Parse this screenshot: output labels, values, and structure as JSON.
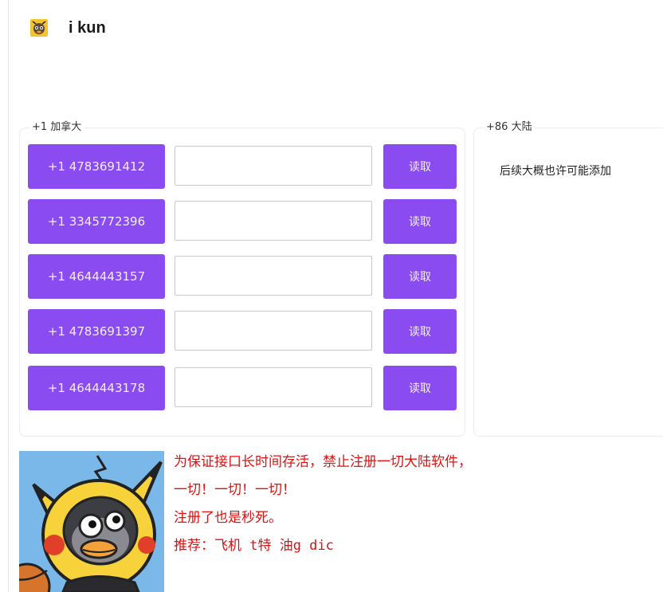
{
  "app": {
    "title": "i kun",
    "logo_icon": "kun-mascot-icon"
  },
  "panels": {
    "canada": {
      "legend": "+1 加拿大",
      "read_label": "读取",
      "numbers": [
        "+1 4783691412",
        "+1 3345772396",
        "+1 4644443157",
        "+1 4783691397",
        "+1 4644443178"
      ]
    },
    "china": {
      "legend": "+86 大陆",
      "note": "后续大概也许可能添加"
    }
  },
  "notice": {
    "lines": [
      "为保证接口长时间存活，禁止注册一切大陆软件，",
      "一切！一切！一切！",
      "注册了也是秒死。",
      "推荐：飞机 t特 油g  dic"
    ],
    "color": "#e01010"
  },
  "colors": {
    "accent": "#8a4bf0"
  }
}
